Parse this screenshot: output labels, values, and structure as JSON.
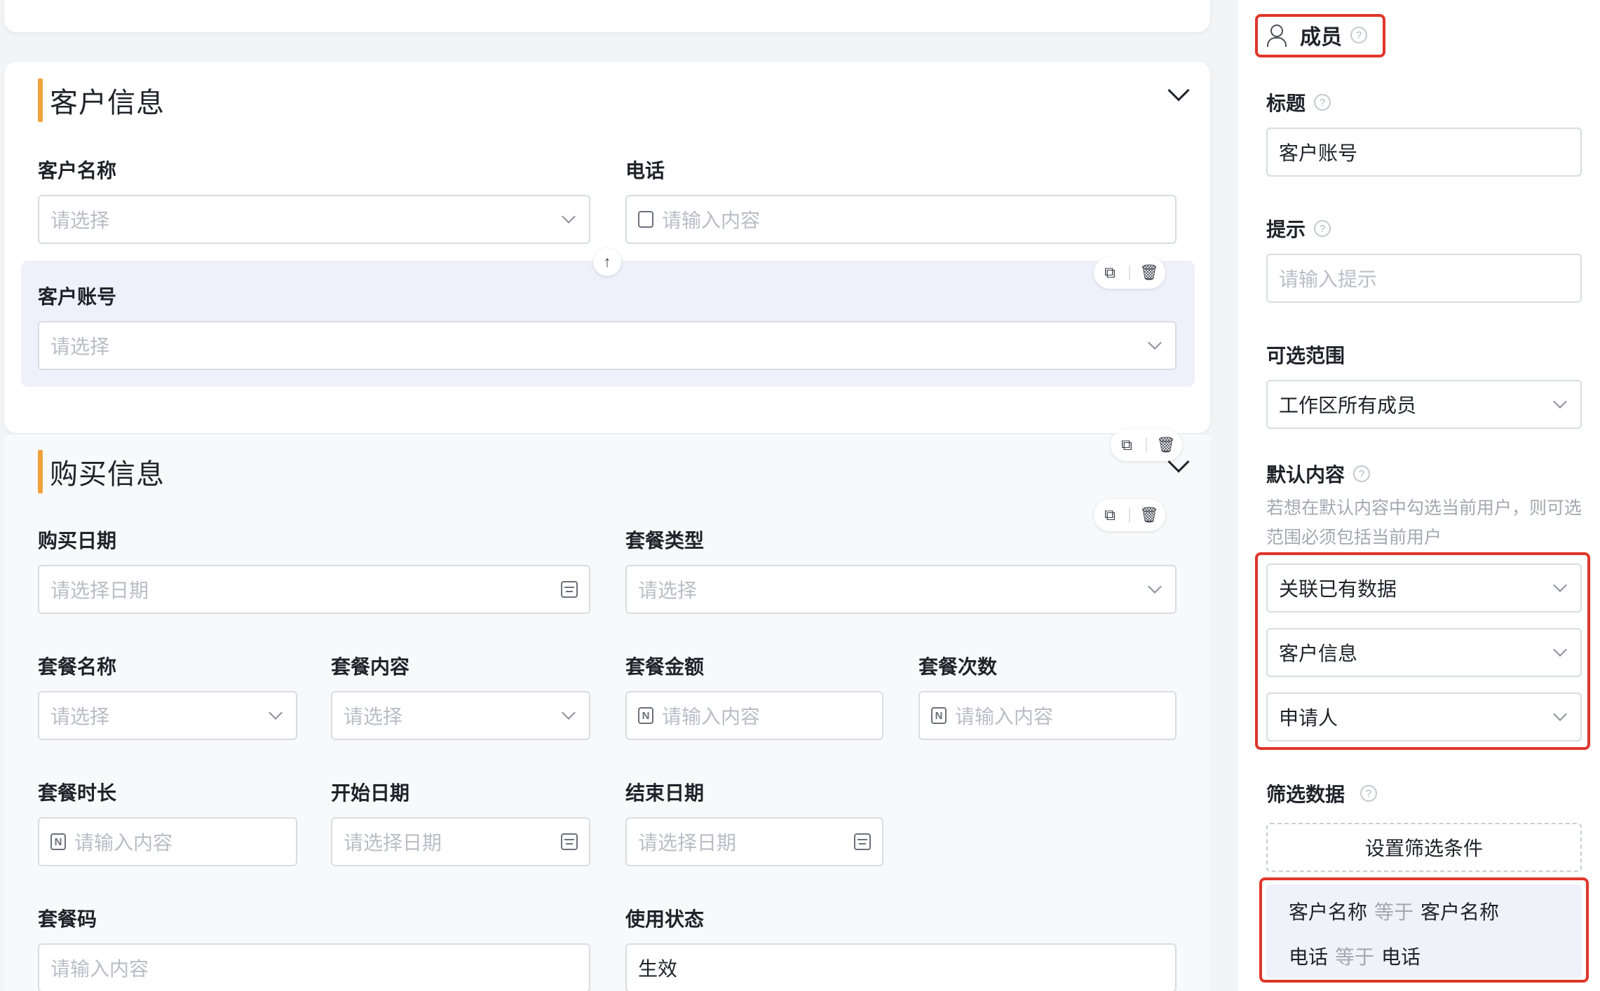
{
  "customer_section": {
    "title": "客户信息",
    "fields": {
      "customer_name": {
        "label": "客户名称",
        "placeholder": "请选择"
      },
      "phone": {
        "label": "电话",
        "placeholder": "请输入内容"
      },
      "customer_account": {
        "label": "客户账号",
        "placeholder": "请选择"
      }
    }
  },
  "purchase_section": {
    "title": "购买信息",
    "fields": {
      "purchase_date": {
        "label": "购买日期",
        "placeholder": "请选择日期"
      },
      "package_type": {
        "label": "套餐类型",
        "placeholder": "请选择"
      },
      "package_name": {
        "label": "套餐名称",
        "placeholder": "请选择"
      },
      "package_content": {
        "label": "套餐内容",
        "placeholder": "请选择"
      },
      "package_amount": {
        "label": "套餐金额",
        "placeholder": "请输入内容"
      },
      "package_count": {
        "label": "套餐次数",
        "placeholder": "请输入内容"
      },
      "package_duration": {
        "label": "套餐时长",
        "placeholder": "请输入内容"
      },
      "start_date": {
        "label": "开始日期",
        "placeholder": "请选择日期"
      },
      "end_date": {
        "label": "结束日期",
        "placeholder": "请选择日期"
      },
      "package_code": {
        "label": "套餐码",
        "placeholder": "请输入内容"
      },
      "usage_status": {
        "label": "使用状态",
        "value": "生效"
      }
    }
  },
  "panel": {
    "header": "成员",
    "title_label": "标题",
    "title_value": "客户账号",
    "hint_label": "提示",
    "hint_placeholder": "请输入提示",
    "range_label": "可选范围",
    "range_value": "工作区所有成员",
    "default_label": "默认内容",
    "default_hint": "若想在默认内容中勾选当前用户，则可选范围必须包括当前用户",
    "default_source": "关联已有数据",
    "default_form": "客户信息",
    "default_field": "申请人",
    "filter_label": "筛选数据",
    "filter_button": "设置筛选条件",
    "conditions": [
      {
        "left": "客户名称",
        "op": "等于",
        "right": "客户名称"
      },
      {
        "left": "电话",
        "op": "等于",
        "right": "电话"
      }
    ]
  },
  "icons": {
    "help": "?",
    "text_field_prefix": "N"
  },
  "colors": {
    "accent": "#f0a23b",
    "highlight": "#e0362b",
    "selected_bg": "#eef0fb"
  }
}
